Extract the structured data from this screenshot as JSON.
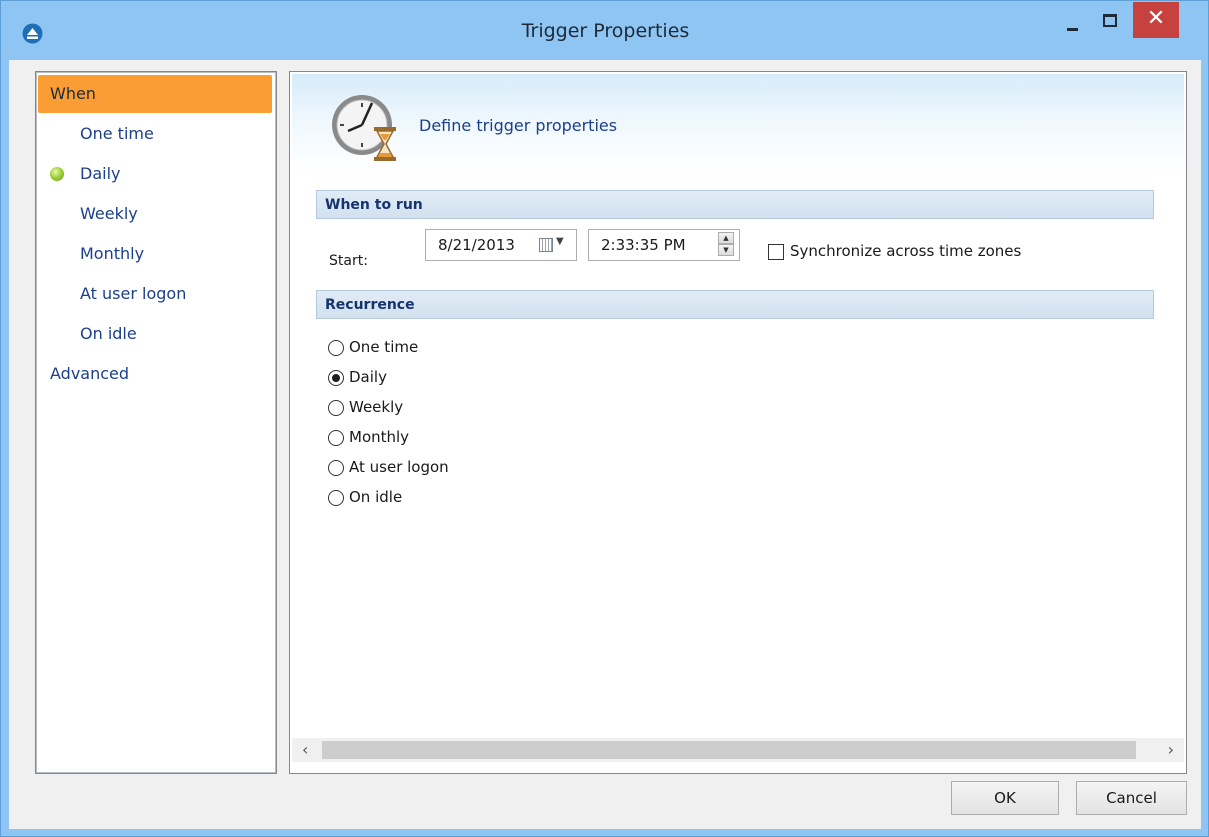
{
  "window": {
    "title": "Trigger Properties",
    "close_glyph": "✕"
  },
  "nav": {
    "items": [
      {
        "label": "When",
        "level": 1,
        "active": true
      },
      {
        "label": "One time",
        "level": 2
      },
      {
        "label": "Daily",
        "level": 2,
        "status": "green-dot"
      },
      {
        "label": "Weekly",
        "level": 2
      },
      {
        "label": "Monthly",
        "level": 2
      },
      {
        "label": "At user logon",
        "level": 2
      },
      {
        "label": "On idle",
        "level": 2
      },
      {
        "label": "Advanced",
        "level": 1
      }
    ]
  },
  "header": {
    "icon": "clock-hourglass-icon",
    "text": "Define trigger properties"
  },
  "when_to_run": {
    "section_title": "When to run",
    "start_label": "Start:",
    "date_value": "8/21/2013",
    "time_value": "2:33:35 PM",
    "sync_label": "Synchronize across time zones",
    "sync_checked": false
  },
  "recurrence": {
    "section_title": "Recurrence",
    "options": [
      "One time",
      "Daily",
      "Weekly",
      "Monthly",
      "At user logon",
      "On idle"
    ],
    "selected": "Daily"
  },
  "buttons": {
    "ok": "OK",
    "cancel": "Cancel"
  },
  "colors": {
    "title_bar": "#8ec5f2",
    "nav_active": "#fb9d35",
    "nav_text": "#1b3f8c",
    "close_button": "#c7423f"
  }
}
